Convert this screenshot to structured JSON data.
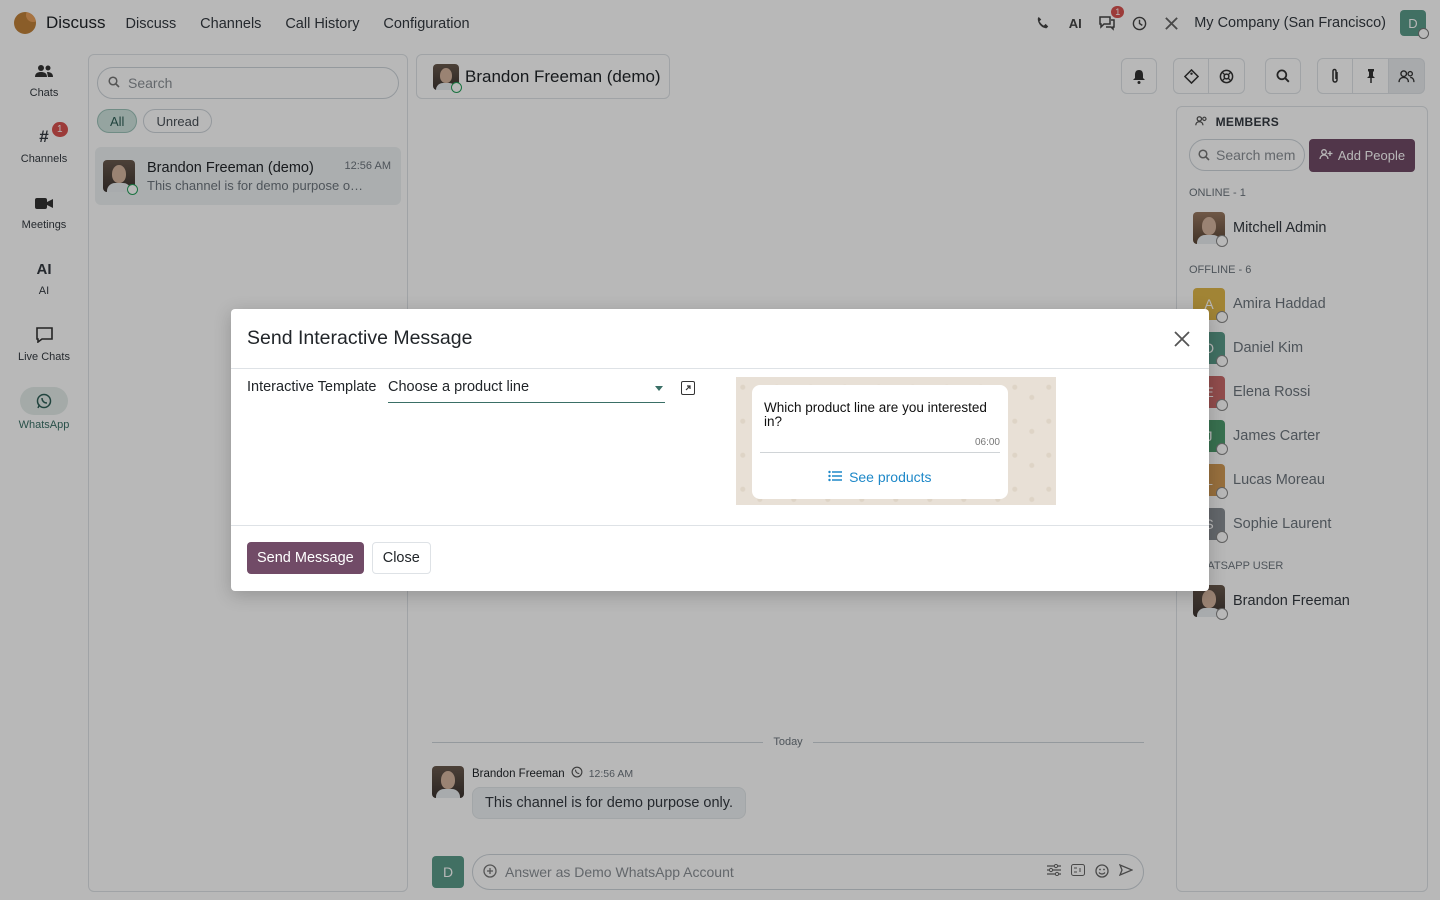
{
  "topbar": {
    "app_name": "Discuss",
    "nav": [
      "Discuss",
      "Channels",
      "Call History",
      "Configuration"
    ],
    "company": "My Company (San Francisco)",
    "messages_badge": "1",
    "user_initial": "D"
  },
  "rail": {
    "items": [
      {
        "label": "Chats",
        "icon": "users-icon"
      },
      {
        "label": "Channels",
        "icon": "hash-icon",
        "badge": "1"
      },
      {
        "label": "Meetings",
        "icon": "video-icon"
      },
      {
        "label": "AI",
        "icon": "ai-icon"
      },
      {
        "label": "Live Chats",
        "icon": "chat-bubble-icon"
      },
      {
        "label": "WhatsApp",
        "icon": "whatsapp-icon"
      }
    ]
  },
  "sidebar": {
    "search_placeholder": "Search",
    "filters": [
      "All",
      "Unread"
    ],
    "conversation": {
      "name": "Brandon Freeman (demo)",
      "time": "12:56 AM",
      "preview": "This channel is for demo purpose o…"
    }
  },
  "thread": {
    "title": "Brandon Freeman (demo)",
    "day_separator": "Today",
    "message": {
      "author": "Brandon Freeman",
      "time": "12:56 AM",
      "text": "This channel is for demo purpose only."
    },
    "composer_placeholder": "Answer as Demo WhatsApp Account",
    "composer_initial": "D"
  },
  "members": {
    "title": "MEMBERS",
    "search_placeholder": "Search mem",
    "add_label": "Add People",
    "online_header": "ONLINE - 1",
    "online": [
      {
        "name": "Mitchell Admin"
      }
    ],
    "offline_header": "OFFLINE - 6",
    "offline": [
      {
        "name": "Amira Haddad",
        "initial": "A",
        "color": "#e0b84a"
      },
      {
        "name": "Daniel Kim",
        "initial": "D",
        "color": "#5b9b8a"
      },
      {
        "name": "Elena Rossi",
        "initial": "E",
        "color": "#c96a6a"
      },
      {
        "name": "James Carter",
        "initial": "J",
        "color": "#4e9b6e"
      },
      {
        "name": "Lucas Moreau",
        "initial": "L",
        "color": "#d19a55"
      },
      {
        "name": "Sophie Laurent",
        "initial": "S",
        "color": "#8a8f95"
      }
    ],
    "whatsapp_header": "WHATSAPP USER",
    "whatsapp_user": "Brandon Freeman"
  },
  "dialog": {
    "title": "Send Interactive Message",
    "field_label": "Interactive Template",
    "field_value": "Choose a product line",
    "preview": {
      "text": "Which product line are you interested in?",
      "time": "06:00",
      "button": "See products"
    },
    "send_label": "Send Message",
    "close_label": "Close"
  },
  "colors": {
    "primary": "#714b67",
    "accent": "#3a6f66",
    "badge": "#d9534f"
  }
}
